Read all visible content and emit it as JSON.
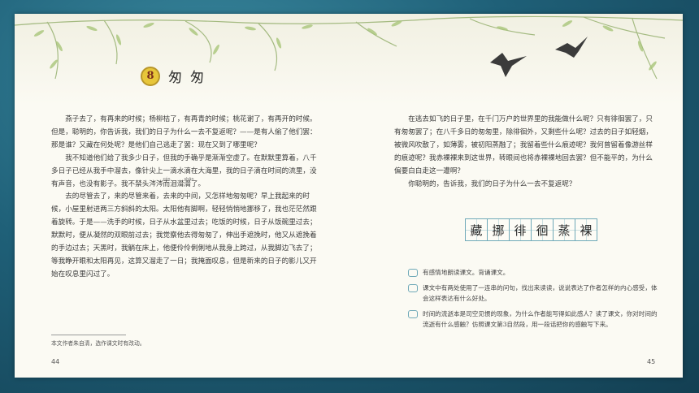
{
  "lesson": {
    "number": "8",
    "title": "匆匆"
  },
  "left_paragraphs": [
    "燕子去了，有再来的时候；杨柳枯了，有再青的时候；桃花谢了，有再开的时候。但是，聪明的，你告诉我，我们的日子为什么一去不复返呢？——是有人偷了他们罢：那是谁？又藏在何处呢？是他们自己逃走了罢：现在又到了哪里呢？",
    "我不知道他们给了我多少日子，但我的手确乎是渐渐空虚了。在默默里算着，八千多日子已经从我手中溜去，像针尖上一滴水滴在大海里，我的日子滴在时间的流里，没有声音，也没有影子。我不禁头",
    "去的尽管去了，来的尽管来着，去来的中间，又怎样地匆匆呢？早上我起来的时候，小屋里射进两三方斜斜的太阳。太阳他有脚啊，轻轻悄悄地挪移了，我也茫茫然跟着旋转。于是——洗手的时候，日子从水盆里过去；吃饭的时候，日子从饭碗里过去；默默时，便从凝然的双眼前过去；我觉察他去得匆匆了，伸出手遮挽时，他又从遮挽着的手边过去；天黑时，我躺在床上，他便伶伶俐俐地从我身上跨过，从我脚边飞去了；等我睁开眼和太阳再见，这算又溜走了一日；我掩面叹息，但是新来的日子的影儿又开始在叹息里闪过了。"
  ],
  "ruby_text": {
    "chan": "涔",
    "chan_pinyin": "cén",
    "shan": "潸",
    "shan_pinyin": "shān",
    "tail": "涔涔而泪潸潸了。"
  },
  "footnote": "本文作者朱自清，选作课文时有改动。",
  "right_paragraphs": [
    "在逃去如飞的日子里，在千门万户的世界里的我能做什么呢？只有徘徊罢了，只有匆匆罢了；在八千多日的匆匆里，除徘徊外，又剩些什么呢？过去的日子如轻烟，被微风吹散了，如薄雾，被初阳蒸融了；我留着些什么痕迹呢？我何曾留着像游丝样的痕迹呢？我赤裸裸来到这世界，转眼间也将赤裸裸地回去罢？但不能平的，为什么偏要白白走这一遭啊？",
    "你聪明的，告诉我，我们的日子为什么一去不复返呢？"
  ],
  "words": [
    "藏",
    "挪",
    "徘",
    "徊",
    "蒸",
    "裸"
  ],
  "exercises": [
    "有感情地朗读课文。背诵课文。",
    "课文中有两处使用了一连串的问句，找出来读读，说说表达了作者怎样的内心感受，体会这样表达有什么好处。",
    "时间的流逝本是司空见惯的现象，为什么作者能写得如此感人？读了课文，你对时间的流逝有什么感触？仿照课文第3自然段，用一段话把你的感触写下来。"
  ],
  "page_numbers": {
    "left": "44",
    "right": "45"
  },
  "colors": {
    "frame": "#1d5a6e",
    "page": "#fbfaf3",
    "accent": "#6fa9b8",
    "badge": "#e7c63a"
  }
}
